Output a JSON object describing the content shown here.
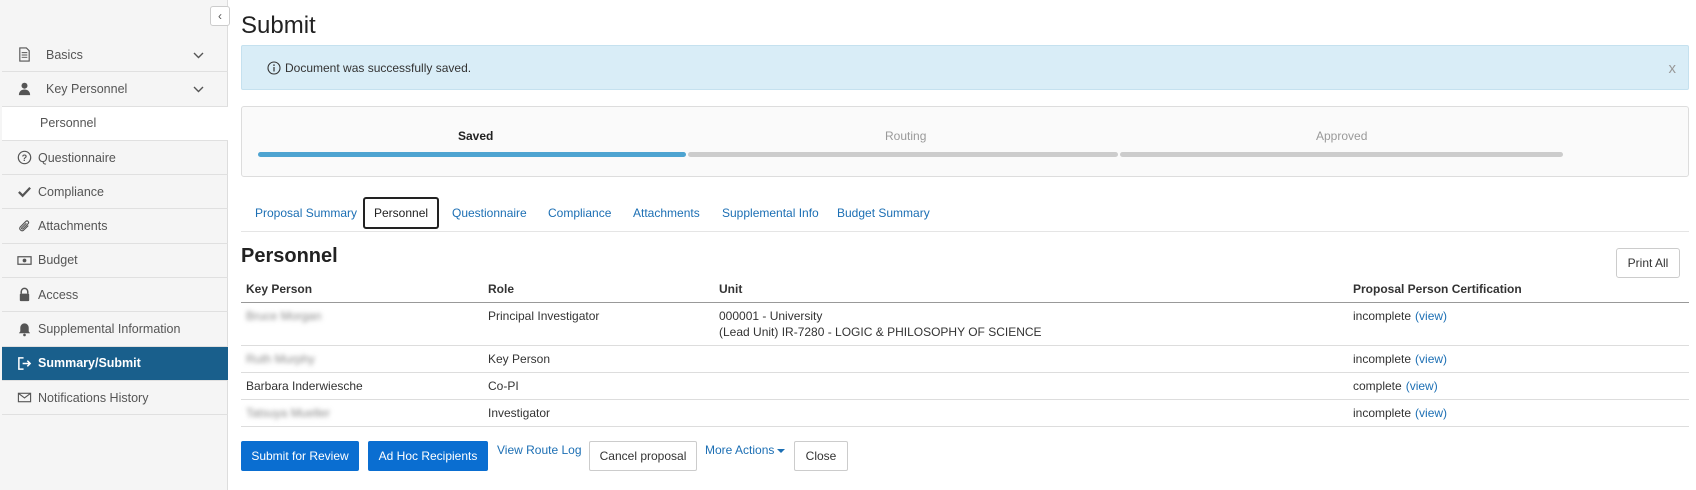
{
  "sidebar": {
    "items": [
      {
        "label": "Basics",
        "icon": "document-icon"
      },
      {
        "label": "Key Personnel",
        "icon": "user-icon"
      },
      {
        "label": "Personnel"
      },
      {
        "label": "Questionnaire",
        "icon": "question-circle-icon"
      },
      {
        "label": "Compliance",
        "icon": "check-icon"
      },
      {
        "label": "Attachments",
        "icon": "paperclip-icon"
      },
      {
        "label": "Budget",
        "icon": "money-icon"
      },
      {
        "label": "Access",
        "icon": "lock-icon"
      },
      {
        "label": "Supplemental Information",
        "icon": "bell-icon"
      },
      {
        "label": "Summary/Submit",
        "icon": "sign-out-icon"
      },
      {
        "label": "Notifications History",
        "icon": "envelope-icon"
      }
    ]
  },
  "page": {
    "title": "Submit"
  },
  "alert": {
    "message": "Document was successfully saved.",
    "close": "x"
  },
  "progress": {
    "steps": [
      "Saved",
      "Routing",
      "Approved"
    ],
    "current": "Saved"
  },
  "tabs": [
    "Proposal Summary",
    "Personnel",
    "Questionnaire",
    "Compliance",
    "Attachments",
    "Supplemental Info",
    "Budget Summary"
  ],
  "section": {
    "title": "Personnel",
    "print_all": "Print All"
  },
  "table": {
    "headers": [
      "Key Person",
      "Role",
      "Unit",
      "Proposal Person Certification"
    ],
    "rows": [
      {
        "person": "Bruce Morgan",
        "role": "Principal Investigator",
        "unit_line1": "000001 - University",
        "unit_line2": "(Lead Unit) IR-7280 - LOGIC & PHILOSOPHY OF SCIENCE",
        "status": "incomplete",
        "link": "(view)"
      },
      {
        "person": "Ruth Murphy",
        "role": "Key Person",
        "unit_line1": "",
        "unit_line2": "",
        "status": "incomplete",
        "link": "(view)"
      },
      {
        "person": "Barbara Inderwiesche",
        "role": "Co-PI",
        "unit_line1": "",
        "unit_line2": "",
        "status": "complete",
        "link": "(view)"
      },
      {
        "person": "Tatsuya Mueller",
        "role": "Investigator",
        "unit_line1": "",
        "unit_line2": "",
        "status": "incomplete",
        "link": "(view)"
      }
    ]
  },
  "actions": {
    "submit": "Submit for Review",
    "adhoc": "Ad Hoc Recipients",
    "route_log": "View Route Log",
    "cancel": "Cancel proposal",
    "more": "More Actions",
    "close": "Close"
  },
  "colors": {
    "active_nav": "#195f8c",
    "progress_done": "#4ea4d1",
    "progress_todo": "#cccccc",
    "primary_button": "#0a6ed1",
    "link": "#1c6fb4",
    "alert_bg": "#d9edf7"
  }
}
